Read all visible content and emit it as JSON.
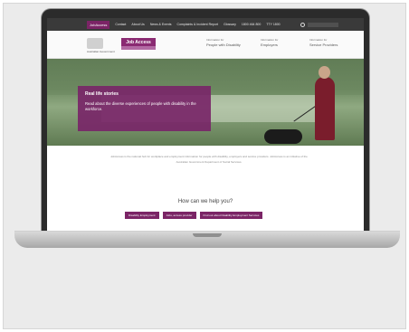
{
  "topnav": {
    "badge": "JobAccess",
    "items": [
      "Contact",
      "About Us",
      "News & Events",
      "Complaints & Incident Report",
      "Glossary",
      "1800 464 800",
      "TTY 1800"
    ],
    "search_placeholder": ""
  },
  "header": {
    "crest_text": "Australian Government",
    "logo_text": "Job Access",
    "nav": [
      {
        "small": "Information for",
        "label": "People with Disability"
      },
      {
        "small": "Information for",
        "label": "Employers"
      },
      {
        "small": "Information for",
        "label": "Service Providers"
      }
    ]
  },
  "hero": {
    "title": "Real life stories",
    "description": "Read about the diverse experiences of people with disability in the workforce."
  },
  "intro_text": "JobAccess is the national hub for workplace and employment information for people with disability, employers and service providers. JobAccess is an initiative of the Australian Government Department of Social Services.",
  "help": {
    "title": "How can we help you?",
    "buttons": [
      "Disability Employment",
      "Jobs, access provider",
      "Find out about Disability Employment Services"
    ]
  },
  "colors": {
    "brand": "#7b2466",
    "nav_bg": "#3a3a3a"
  }
}
